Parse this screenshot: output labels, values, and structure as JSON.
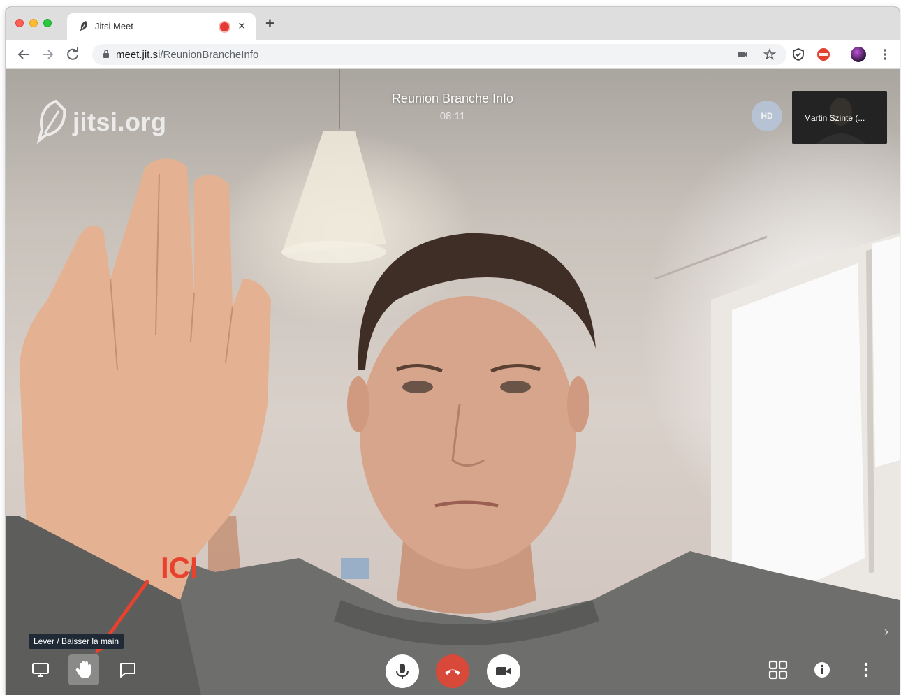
{
  "browser": {
    "tab_title": "Jitsi Meet",
    "tab_close": "×",
    "new_tab": "+",
    "url_host": "meet.jit.si",
    "url_path": "/ReunionBrancheInfo"
  },
  "meeting": {
    "watermark": "jitsi.org",
    "title": "Reunion Branche Info",
    "duration": "08:11",
    "avatar_initials": "HD",
    "thumbnail_name": "Martin Szinte (..."
  },
  "toolbar": {
    "tooltip": "Lever / Baisser la main",
    "annotation": "ICI"
  },
  "colors": {
    "hangup": "#d8493a",
    "annotation": "#e8412d",
    "tooltip_bg": "#1f2a36"
  }
}
